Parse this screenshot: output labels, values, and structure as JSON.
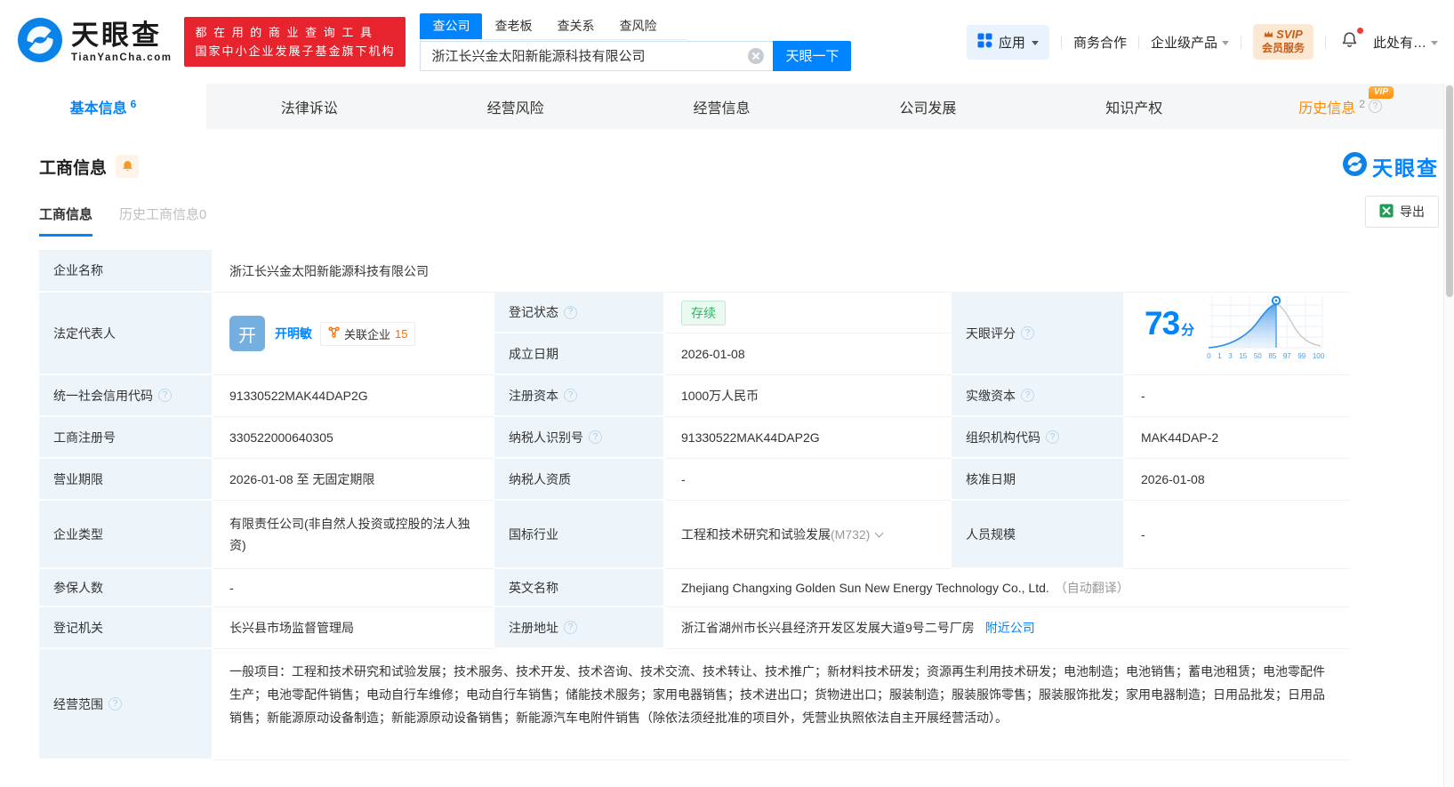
{
  "colors": {
    "brand_blue": "#0084ff",
    "promo_red": "#e7232e",
    "status_green": "#2db568",
    "vip_orange": "#ff9012",
    "svip_text": "#c4601e",
    "label_cell_bg": "#edf5fb"
  },
  "misc": {
    "help_glyph": "?",
    "vip": "VIP"
  },
  "header": {
    "logo": {
      "brand": "天眼查",
      "domain": "TianYanCha.com"
    },
    "promo": {
      "line1": "都 在 用 的 商 业 查 询 工 具",
      "line2": "国家中小企业发展子基金旗下机构"
    },
    "search": {
      "tabs": [
        {
          "label": "查公司"
        },
        {
          "label": "查老板"
        },
        {
          "label": "查关系"
        },
        {
          "label": "查风险"
        }
      ],
      "value": "浙江长兴金太阳新能源科技有限公司",
      "button": "天眼一下"
    },
    "nav": {
      "apps": "应用",
      "cooperation": "商务合作",
      "enterprise": "企业级产品",
      "svip_line1": "SVIP",
      "svip_line2": "会员服务",
      "user": "此处有…"
    }
  },
  "tabs": [
    {
      "label": "基本信息",
      "count": "6"
    },
    {
      "label": "法律诉讼"
    },
    {
      "label": "经营风险"
    },
    {
      "label": "经营信息"
    },
    {
      "label": "公司发展"
    },
    {
      "label": "知识产权"
    },
    {
      "label": "历史信息",
      "count": "2"
    }
  ],
  "section": {
    "title": "工商信息",
    "watermark": "天眼查",
    "subtabs": [
      {
        "label": "工商信息"
      },
      {
        "label": "历史工商信息0"
      }
    ],
    "export": "导出"
  },
  "table": {
    "company_name": {
      "label": "企业名称",
      "value": "浙江长兴金太阳新能源科技有限公司"
    },
    "legal_rep": {
      "label": "法定代表人",
      "avatar": "开",
      "name": "开明敏",
      "related_label": "关联企业",
      "related_count": "15"
    },
    "reg_status": {
      "label": "登记状态",
      "value": "存续"
    },
    "est_date": {
      "label": "成立日期",
      "value": "2026-01-08"
    },
    "score": {
      "label": "天眼评分",
      "value": "73",
      "unit": "分",
      "axis": [
        "0",
        "1",
        "3",
        "15",
        "50",
        "85",
        "97",
        "99",
        "100"
      ]
    },
    "credit_code": {
      "label": "统一社会信用代码",
      "value": "91330522MAK44DAP2G"
    },
    "reg_capital": {
      "label": "注册资本",
      "value": "1000万人民币"
    },
    "paid_capital": {
      "label": "实缴资本",
      "value": "-"
    },
    "reg_number": {
      "label": "工商注册号",
      "value": "330522000640305"
    },
    "taxpayer_id": {
      "label": "纳税人识别号",
      "value": "91330522MAK44DAP2G"
    },
    "org_code": {
      "label": "组织机构代码",
      "value": "MAK44DAP-2"
    },
    "business_term": {
      "label": "营业期限",
      "value": "2026-01-08 至 无固定期限"
    },
    "taxpayer_quality": {
      "label": "纳税人资质",
      "value": "-"
    },
    "approval_date": {
      "label": "核准日期",
      "value": "2026-01-08"
    },
    "company_type": {
      "label": "企业类型",
      "value": "有限责任公司(非自然人投资或控股的法人独资)"
    },
    "industry": {
      "label": "国标行业",
      "value": "工程和技术研究和试验发展",
      "code": "(M732)"
    },
    "staff_size": {
      "label": "人员规模",
      "value": "-"
    },
    "insured_count": {
      "label": "参保人数",
      "value": "-"
    },
    "english_name": {
      "label": "英文名称",
      "value": "Zhejiang Changxing Golden Sun New Energy Technology Co., Ltd.",
      "note": "（自动翻译）"
    },
    "reg_authority": {
      "label": "登记机关",
      "value": "长兴县市场监督管理局"
    },
    "reg_address": {
      "label": "注册地址",
      "value": "浙江省湖州市长兴县经济开发区发展大道9号二号厂房",
      "link": "附近公司"
    },
    "business_scope": {
      "label": "经营范围",
      "value": "一般项目：工程和技术研究和试验发展；技术服务、技术开发、技术咨询、技术交流、技术转让、技术推广；新材料技术研发；资源再生利用技术研发；电池制造；电池销售；蓄电池租赁；电池零配件生产；电池零配件销售；电动自行车维修；电动自行车销售；储能技术服务；家用电器销售；技术进出口；货物进出口；服装制造；服装服饰零售；服装服饰批发；家用电器制造；日用品批发；日用品销售；新能源原动设备制造；新能源原动设备销售；新能源汽车电附件销售（除依法须经批准的项目外，凭营业执照依法自主开展经营活动）。"
    }
  }
}
